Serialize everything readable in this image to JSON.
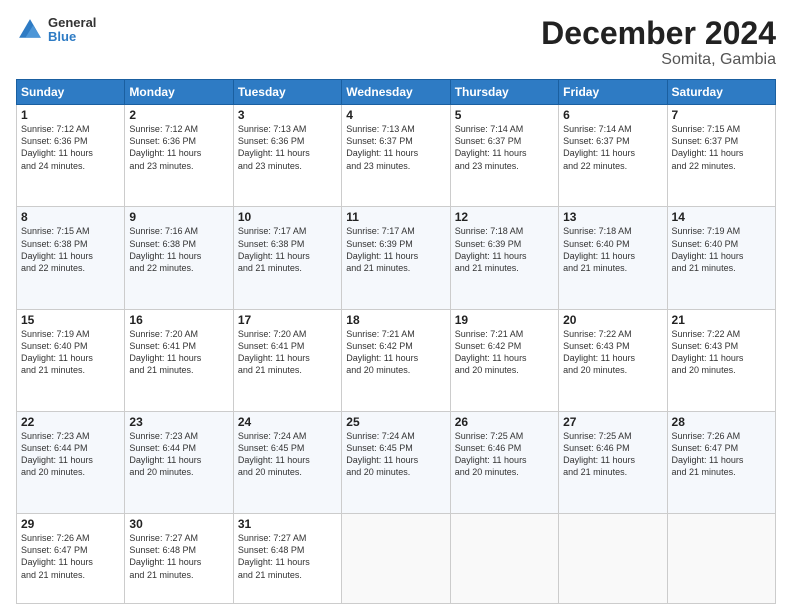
{
  "logo": {
    "line1": "General",
    "line2": "Blue"
  },
  "title": "December 2024",
  "subtitle": "Somita, Gambia",
  "weekdays": [
    "Sunday",
    "Monday",
    "Tuesday",
    "Wednesday",
    "Thursday",
    "Friday",
    "Saturday"
  ],
  "weeks": [
    [
      {
        "day": "1",
        "text": "Sunrise: 7:12 AM\nSunset: 6:36 PM\nDaylight: 11 hours\nand 24 minutes."
      },
      {
        "day": "2",
        "text": "Sunrise: 7:12 AM\nSunset: 6:36 PM\nDaylight: 11 hours\nand 23 minutes."
      },
      {
        "day": "3",
        "text": "Sunrise: 7:13 AM\nSunset: 6:36 PM\nDaylight: 11 hours\nand 23 minutes."
      },
      {
        "day": "4",
        "text": "Sunrise: 7:13 AM\nSunset: 6:37 PM\nDaylight: 11 hours\nand 23 minutes."
      },
      {
        "day": "5",
        "text": "Sunrise: 7:14 AM\nSunset: 6:37 PM\nDaylight: 11 hours\nand 23 minutes."
      },
      {
        "day": "6",
        "text": "Sunrise: 7:14 AM\nSunset: 6:37 PM\nDaylight: 11 hours\nand 22 minutes."
      },
      {
        "day": "7",
        "text": "Sunrise: 7:15 AM\nSunset: 6:37 PM\nDaylight: 11 hours\nand 22 minutes."
      }
    ],
    [
      {
        "day": "8",
        "text": "Sunrise: 7:15 AM\nSunset: 6:38 PM\nDaylight: 11 hours\nand 22 minutes."
      },
      {
        "day": "9",
        "text": "Sunrise: 7:16 AM\nSunset: 6:38 PM\nDaylight: 11 hours\nand 22 minutes."
      },
      {
        "day": "10",
        "text": "Sunrise: 7:17 AM\nSunset: 6:38 PM\nDaylight: 11 hours\nand 21 minutes."
      },
      {
        "day": "11",
        "text": "Sunrise: 7:17 AM\nSunset: 6:39 PM\nDaylight: 11 hours\nand 21 minutes."
      },
      {
        "day": "12",
        "text": "Sunrise: 7:18 AM\nSunset: 6:39 PM\nDaylight: 11 hours\nand 21 minutes."
      },
      {
        "day": "13",
        "text": "Sunrise: 7:18 AM\nSunset: 6:40 PM\nDaylight: 11 hours\nand 21 minutes."
      },
      {
        "day": "14",
        "text": "Sunrise: 7:19 AM\nSunset: 6:40 PM\nDaylight: 11 hours\nand 21 minutes."
      }
    ],
    [
      {
        "day": "15",
        "text": "Sunrise: 7:19 AM\nSunset: 6:40 PM\nDaylight: 11 hours\nand 21 minutes."
      },
      {
        "day": "16",
        "text": "Sunrise: 7:20 AM\nSunset: 6:41 PM\nDaylight: 11 hours\nand 21 minutes."
      },
      {
        "day": "17",
        "text": "Sunrise: 7:20 AM\nSunset: 6:41 PM\nDaylight: 11 hours\nand 21 minutes."
      },
      {
        "day": "18",
        "text": "Sunrise: 7:21 AM\nSunset: 6:42 PM\nDaylight: 11 hours\nand 20 minutes."
      },
      {
        "day": "19",
        "text": "Sunrise: 7:21 AM\nSunset: 6:42 PM\nDaylight: 11 hours\nand 20 minutes."
      },
      {
        "day": "20",
        "text": "Sunrise: 7:22 AM\nSunset: 6:43 PM\nDaylight: 11 hours\nand 20 minutes."
      },
      {
        "day": "21",
        "text": "Sunrise: 7:22 AM\nSunset: 6:43 PM\nDaylight: 11 hours\nand 20 minutes."
      }
    ],
    [
      {
        "day": "22",
        "text": "Sunrise: 7:23 AM\nSunset: 6:44 PM\nDaylight: 11 hours\nand 20 minutes."
      },
      {
        "day": "23",
        "text": "Sunrise: 7:23 AM\nSunset: 6:44 PM\nDaylight: 11 hours\nand 20 minutes."
      },
      {
        "day": "24",
        "text": "Sunrise: 7:24 AM\nSunset: 6:45 PM\nDaylight: 11 hours\nand 20 minutes."
      },
      {
        "day": "25",
        "text": "Sunrise: 7:24 AM\nSunset: 6:45 PM\nDaylight: 11 hours\nand 20 minutes."
      },
      {
        "day": "26",
        "text": "Sunrise: 7:25 AM\nSunset: 6:46 PM\nDaylight: 11 hours\nand 20 minutes."
      },
      {
        "day": "27",
        "text": "Sunrise: 7:25 AM\nSunset: 6:46 PM\nDaylight: 11 hours\nand 21 minutes."
      },
      {
        "day": "28",
        "text": "Sunrise: 7:26 AM\nSunset: 6:47 PM\nDaylight: 11 hours\nand 21 minutes."
      }
    ],
    [
      {
        "day": "29",
        "text": "Sunrise: 7:26 AM\nSunset: 6:47 PM\nDaylight: 11 hours\nand 21 minutes."
      },
      {
        "day": "30",
        "text": "Sunrise: 7:27 AM\nSunset: 6:48 PM\nDaylight: 11 hours\nand 21 minutes."
      },
      {
        "day": "31",
        "text": "Sunrise: 7:27 AM\nSunset: 6:48 PM\nDaylight: 11 hours\nand 21 minutes."
      },
      {
        "day": "",
        "text": ""
      },
      {
        "day": "",
        "text": ""
      },
      {
        "day": "",
        "text": ""
      },
      {
        "day": "",
        "text": ""
      }
    ]
  ]
}
